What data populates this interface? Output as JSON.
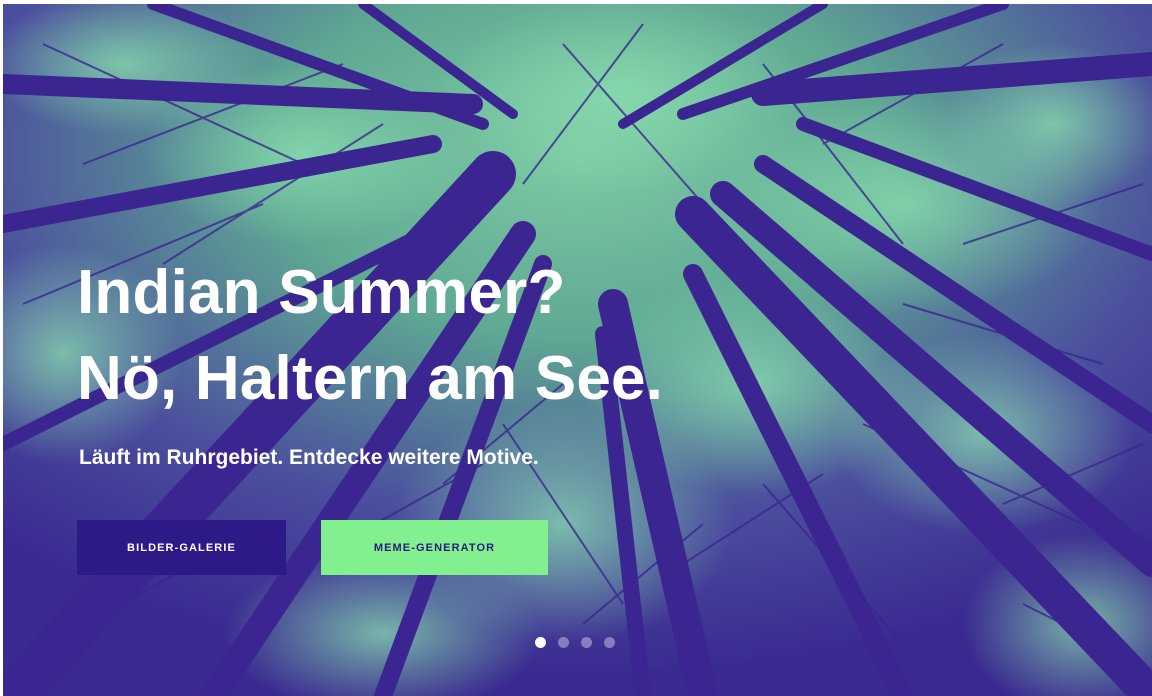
{
  "hero": {
    "background_image": "forest-canopy-duotone",
    "headline_line1": "Indian Summer?",
    "headline_line2": "Nö, Haltern am See.",
    "subline": "Läuft im Ruhrgebiet. Entdecke weitere Motive.",
    "buttons": {
      "gallery_label": "BILDER-GALERIE",
      "meme_label": "MEME-GENERATOR"
    },
    "slider": {
      "slide_count": 4,
      "active_index": 0
    }
  },
  "colors": {
    "duotone_dark": "#3d2a94",
    "duotone_light": "#6fbf9a",
    "button_gallery_bg": "#2e1a86",
    "button_meme_bg": "#83f08f",
    "text": "#ffffff"
  }
}
